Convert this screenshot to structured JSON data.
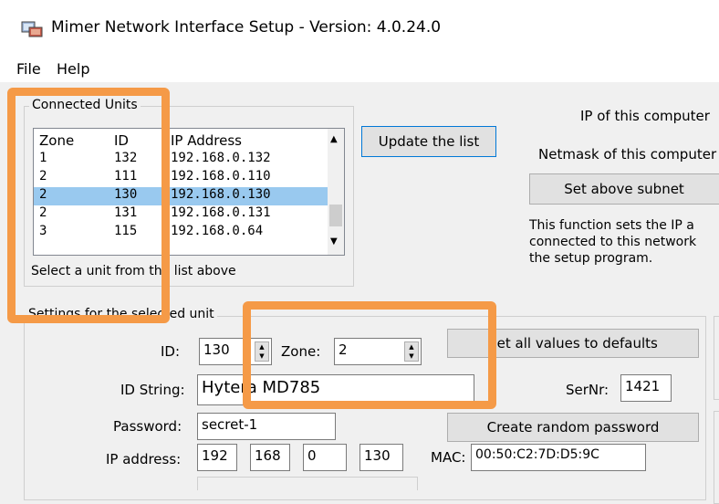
{
  "window": {
    "title": "Mimer Network Interface Setup  -  Version: 4.0.24.0"
  },
  "menu": [
    {
      "label": "File"
    },
    {
      "label": "Help"
    }
  ],
  "connected_units": {
    "label": "Connected Units",
    "columns": [
      "Zone",
      "ID",
      "IP Address"
    ],
    "rows": [
      {
        "zone": "1",
        "id": "132",
        "ip": "192.168.0.132"
      },
      {
        "zone": "2",
        "id": "111",
        "ip": "192.168.0.110"
      },
      {
        "zone": "2",
        "id": "130",
        "ip": "192.168.0.130",
        "selected": true
      },
      {
        "zone": "2",
        "id": "131",
        "ip": "192.168.0.131"
      },
      {
        "zone": "3",
        "id": "115",
        "ip": "192.168.0.64"
      }
    ],
    "hint": "Select a unit from the list above",
    "update_button": "Update the list"
  },
  "computer": {
    "ip_label": "IP of this computer",
    "netmask_label": "Netmask of this computer",
    "set_subnet_button": "Set above subnet",
    "description": [
      "This function sets the IP a",
      "connected to this network",
      "the setup program."
    ]
  },
  "unit_settings": {
    "group_label": "Settings for the selected unit",
    "id_label": "ID:",
    "id_value": "130",
    "zone_label": "Zone:",
    "zone_value": "2",
    "defaults_button": "Set all values to defaults",
    "id_string_label": "ID String:",
    "id_string_value": "Hytera MD785",
    "sernr_label": "SerNr:",
    "sernr_value": "1421",
    "password_label": "Password:",
    "password_value": "secret-1",
    "random_password_button": "Create random password",
    "ip_label": "IP address:",
    "ip_octets": [
      "192",
      "168",
      "0",
      "130"
    ],
    "mac_label": "MAC:",
    "mac_value": "00:50:C2:7D:D5:9C"
  },
  "colors": {
    "annotation": "#f59a47",
    "selection": "#99c9ef",
    "focus_border": "#0078d7"
  }
}
